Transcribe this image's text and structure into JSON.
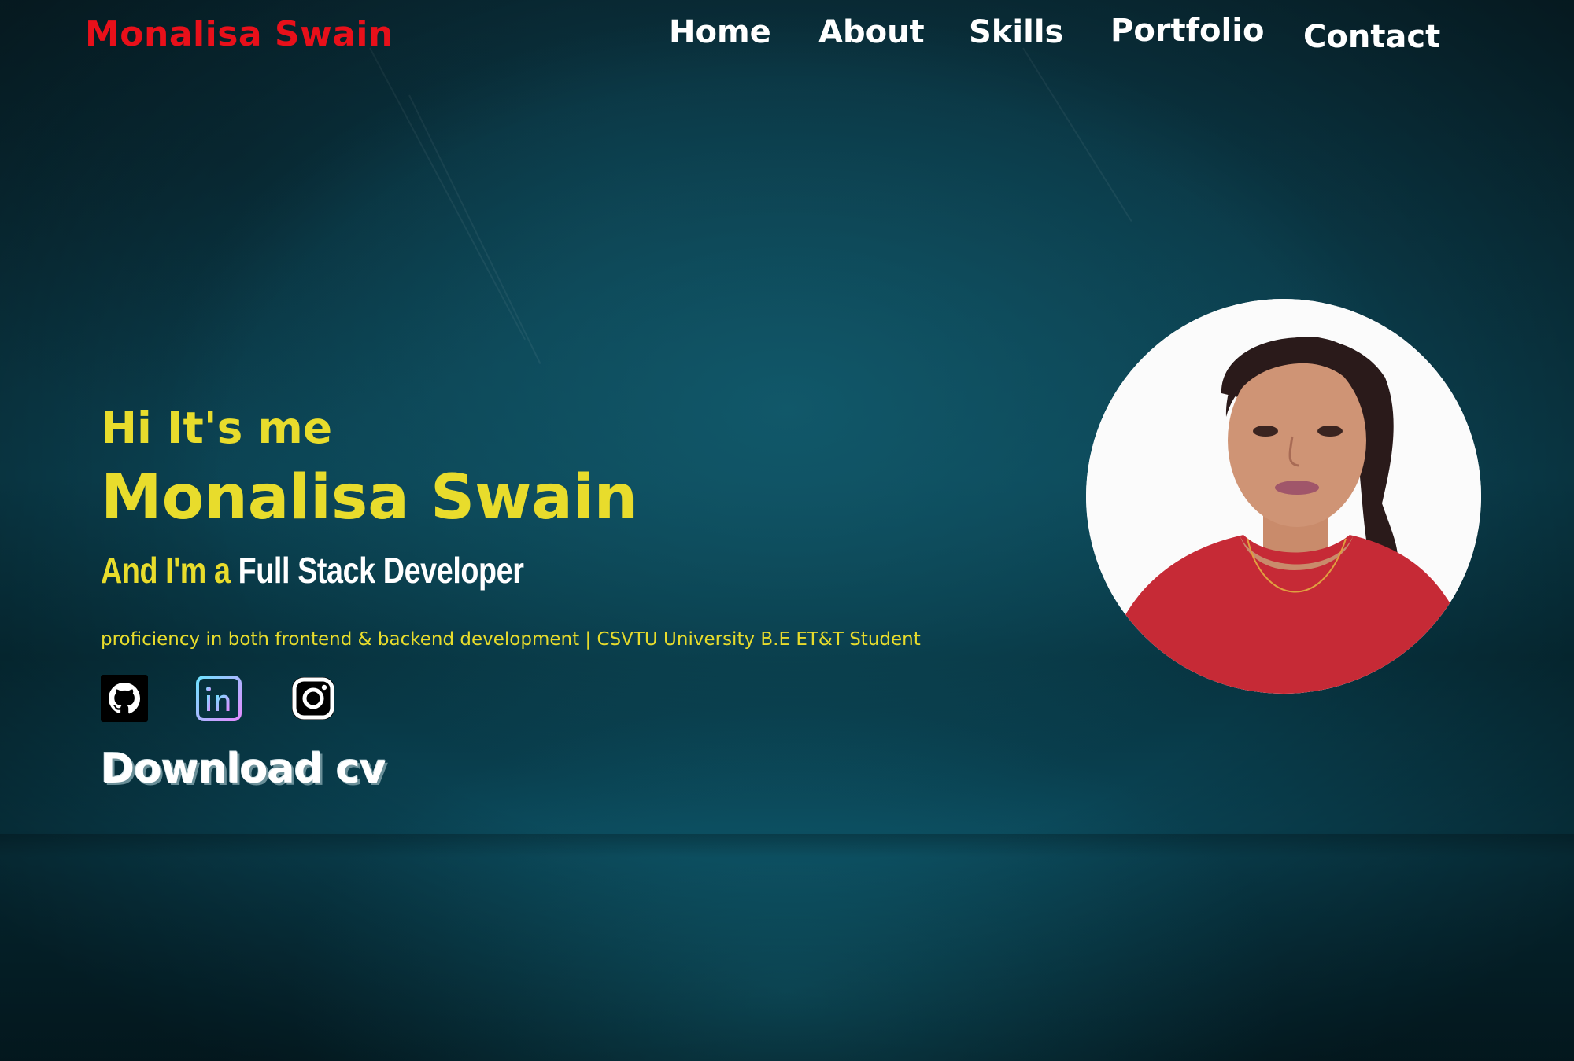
{
  "brand": {
    "name": "Monalisa Swain",
    "color": "#e8101a"
  },
  "nav": {
    "items": [
      {
        "label": "Home"
      },
      {
        "label": "About"
      },
      {
        "label": "Skills"
      },
      {
        "label": "Portfolio"
      },
      {
        "label": "Contact"
      }
    ]
  },
  "hero": {
    "greeting": "Hi It's me",
    "name": "Monalisa Swain",
    "role_prefix": "And I'm a",
    "role_title": "Full Stack Developer",
    "tagline": "proficiency in both frontend & backend development | CSVTU University B.E ET&T Student",
    "download_label": "Download cv",
    "accent_color": "#e8dc2c"
  },
  "socials": [
    {
      "icon": "github-icon"
    },
    {
      "icon": "linkedin-icon"
    },
    {
      "icon": "instagram-icon"
    }
  ],
  "profile_photo": {
    "icon": "profile-photo"
  }
}
